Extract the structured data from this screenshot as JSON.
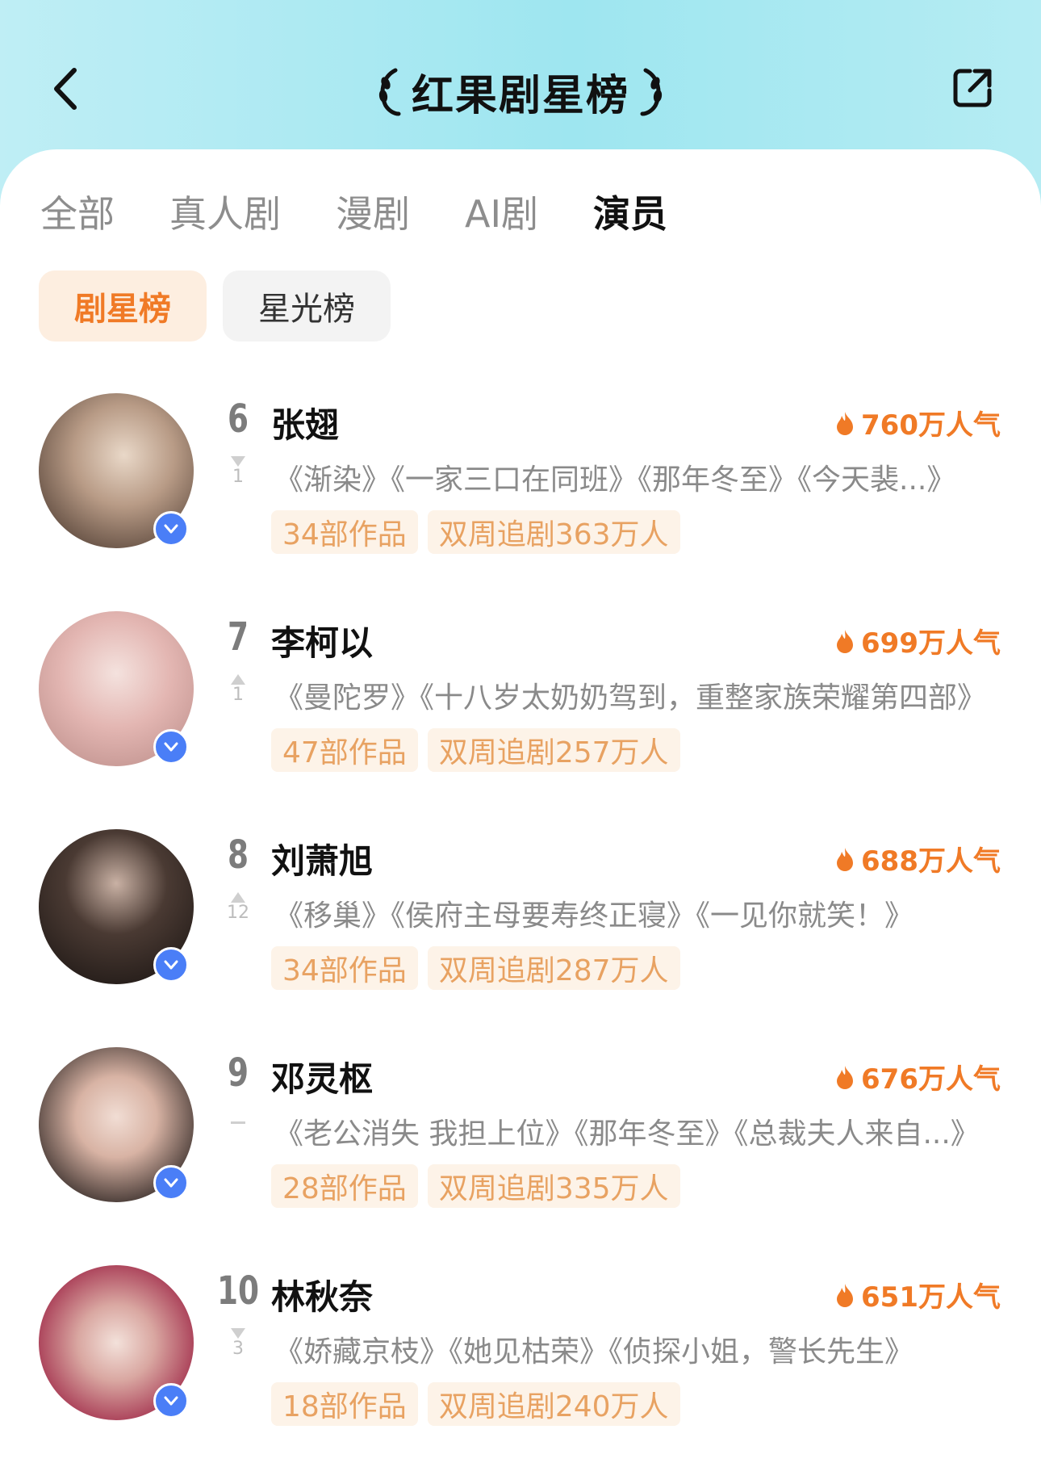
{
  "header": {
    "title": "红果剧星榜"
  },
  "tabs": [
    {
      "label": "全部"
    },
    {
      "label": "真人剧"
    },
    {
      "label": "漫剧"
    },
    {
      "label": "AI剧"
    },
    {
      "label": "演员",
      "active": true
    }
  ],
  "subtabs": [
    {
      "label": "剧星榜",
      "active": true
    },
    {
      "label": "星光榜"
    }
  ],
  "colors": {
    "accent": "#f07a26",
    "tag_text": "#e8a262",
    "tag_bg": "#fdf3e8",
    "verified_badge": "#4a7ef7",
    "header_gradient": "#9ee6f0"
  },
  "ranking": [
    {
      "rank": "6",
      "name": "张翅",
      "popularity": "760万人气",
      "change": "down",
      "change_value": "1",
      "works": "《渐染》《一家三口在同班》《那年冬至》《今天裴...》",
      "tag_works": "34部作品",
      "tag_followers": "双周追剧363万人"
    },
    {
      "rank": "7",
      "name": "李柯以",
      "popularity": "699万人气",
      "change": "up",
      "change_value": "1",
      "works": "《曼陀罗》《十八岁太奶奶驾到，重整家族荣耀第四部》",
      "tag_works": "47部作品",
      "tag_followers": "双周追剧257万人"
    },
    {
      "rank": "8",
      "name": "刘萧旭",
      "popularity": "688万人气",
      "change": "up",
      "change_value": "12",
      "works": "《移巢》《侯府主母要寿终正寝》《一见你就笑！》",
      "tag_works": "34部作品",
      "tag_followers": "双周追剧287万人"
    },
    {
      "rank": "9",
      "name": "邓灵枢",
      "popularity": "676万人气",
      "change": "same",
      "change_value": "",
      "works": "《老公消失 我担上位》《那年冬至》《总裁夫人来自...》",
      "tag_works": "28部作品",
      "tag_followers": "双周追剧335万人"
    },
    {
      "rank": "10",
      "name": "林秋奈",
      "popularity": "651万人气",
      "change": "down",
      "change_value": "3",
      "works": "《娇藏京枝》《她见枯荣》《侦探小姐，警长先生》",
      "tag_works": "18部作品",
      "tag_followers": "双周追剧240万人"
    }
  ]
}
